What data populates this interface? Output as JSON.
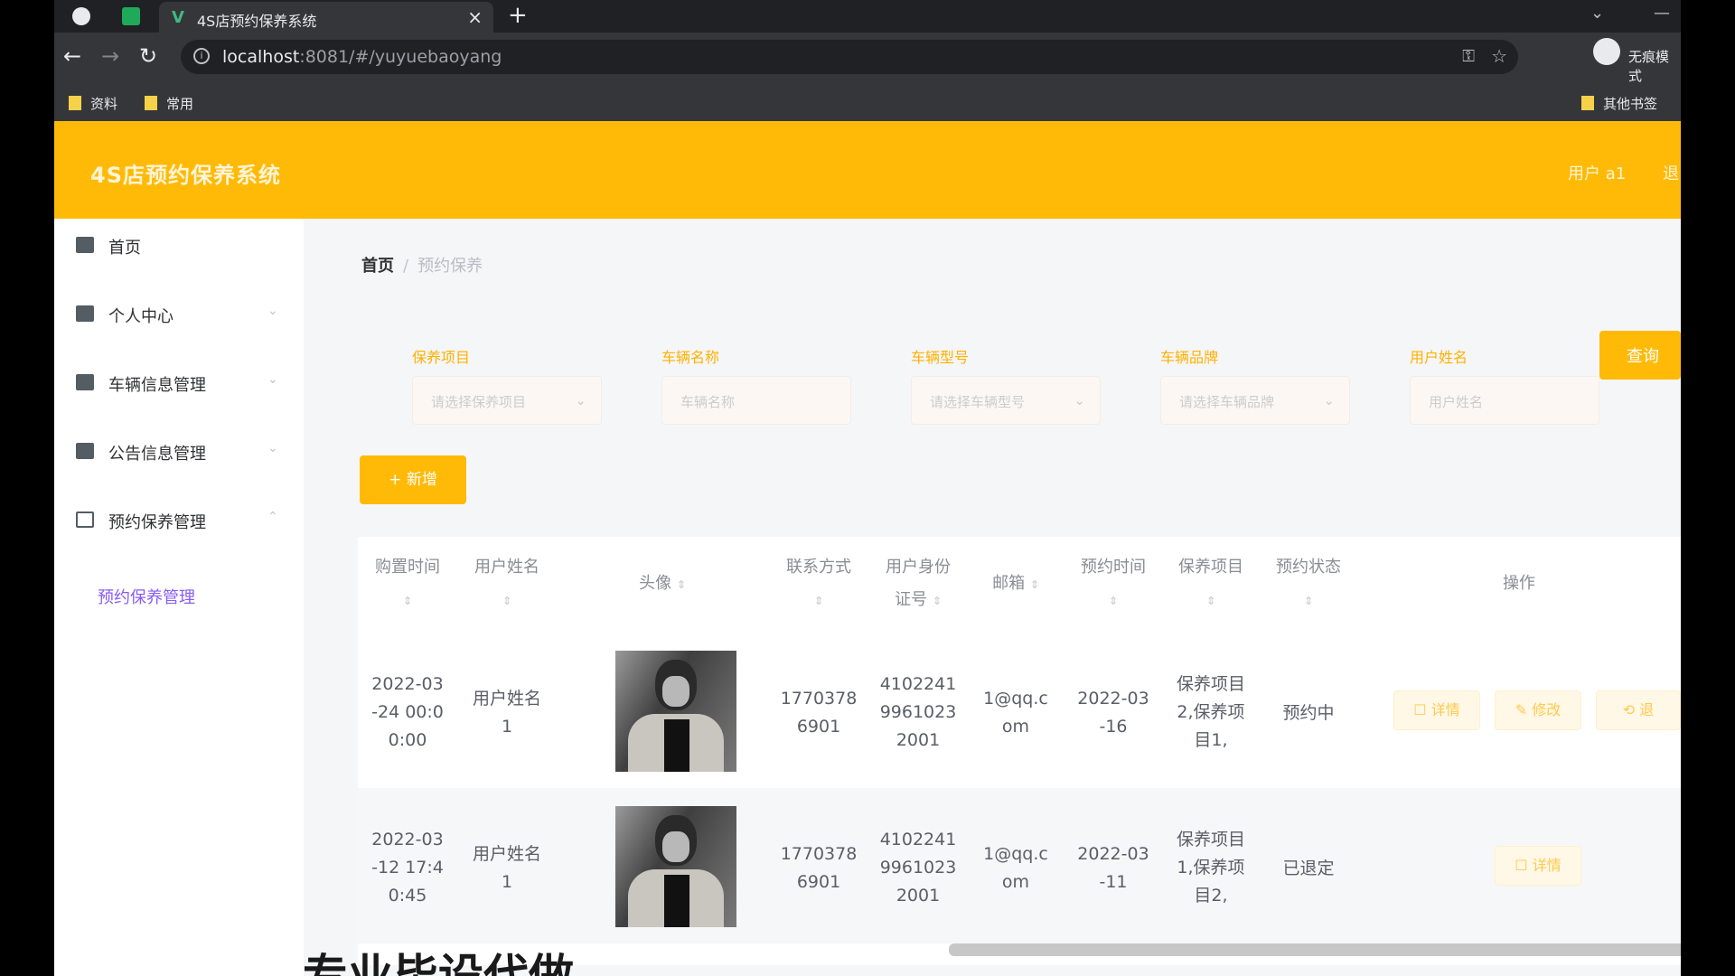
{
  "browser": {
    "tab_title": "4S店预约保养系统",
    "new_tab": "+",
    "tab_close": "×",
    "url_host": "localhost",
    "url_rest": ":8081/#/yuyuebaoyang",
    "profile_label": "无痕模式",
    "bookmarks": [
      "资料",
      "常用"
    ],
    "other_bookmarks": "其他书签"
  },
  "header": {
    "title": "4S店预约保养系统",
    "user": "用户 a1",
    "logout": "退"
  },
  "sidebar": {
    "items": [
      {
        "label": "首页",
        "icon": "home-icon"
      },
      {
        "label": "个人中心",
        "icon": "user-icon"
      },
      {
        "label": "车辆信息管理",
        "icon": "car-icon"
      },
      {
        "label": "公告信息管理",
        "icon": "notice-icon"
      },
      {
        "label": "预约保养管理",
        "icon": "calendar-icon"
      }
    ],
    "sub_item": "预约保养管理"
  },
  "breadcrumb": {
    "home": "首页",
    "separator": "/",
    "current": "预约保养"
  },
  "filters": [
    {
      "label": "保养项目",
      "placeholder": "请选择保养项目",
      "type": "select"
    },
    {
      "label": "车辆名称",
      "placeholder": "车辆名称",
      "type": "input"
    },
    {
      "label": "车辆型号",
      "placeholder": "请选择车辆型号",
      "type": "select"
    },
    {
      "label": "车辆品牌",
      "placeholder": "请选择车辆品牌",
      "type": "select"
    },
    {
      "label": "用户姓名",
      "placeholder": "用户姓名",
      "type": "input"
    }
  ],
  "search_button": "查询",
  "add_button": "+ 新增",
  "table": {
    "headers": {
      "purchase_time": "购置时间",
      "user_name": "用户姓名",
      "avatar": "头像",
      "contact": "联系方式",
      "id_card_a": "用户身份",
      "id_card_b": "证号",
      "email": "邮箱",
      "appoint_time": "预约时间",
      "item": "保养项目",
      "status": "预约状态",
      "ops": "操作"
    },
    "rows": [
      {
        "purchase_time": [
          "2022-03",
          "-24 00:0",
          "0:00"
        ],
        "user_name": [
          "用户姓名",
          "1"
        ],
        "contact": [
          "1770378",
          "6901"
        ],
        "id_card": [
          "4102241",
          "9961023",
          "2001"
        ],
        "email": [
          "1@qq.c",
          "om"
        ],
        "appoint_time": [
          "2022-03",
          "-16"
        ],
        "item": [
          "保养项目",
          "2,保养项",
          "目1,"
        ],
        "status": "预约中",
        "ops": [
          "详情",
          "修改",
          "退"
        ]
      },
      {
        "purchase_time": [
          "2022-03",
          "-12 17:4",
          "0:45"
        ],
        "user_name": [
          "用户姓名",
          "1"
        ],
        "contact": [
          "1770378",
          "6901"
        ],
        "id_card": [
          "4102241",
          "9961023",
          "2001"
        ],
        "email": [
          "1@qq.c",
          "om"
        ],
        "appoint_time": [
          "2022-03",
          "-11"
        ],
        "item": [
          "保养项目",
          "1,保养项",
          "目2,"
        ],
        "status": "已退定",
        "ops": [
          "详情"
        ]
      }
    ]
  },
  "overlay_caption": "专业毕设代做",
  "colors": {
    "brand": "#ffba08",
    "sub_active": "#8a5cf5"
  }
}
